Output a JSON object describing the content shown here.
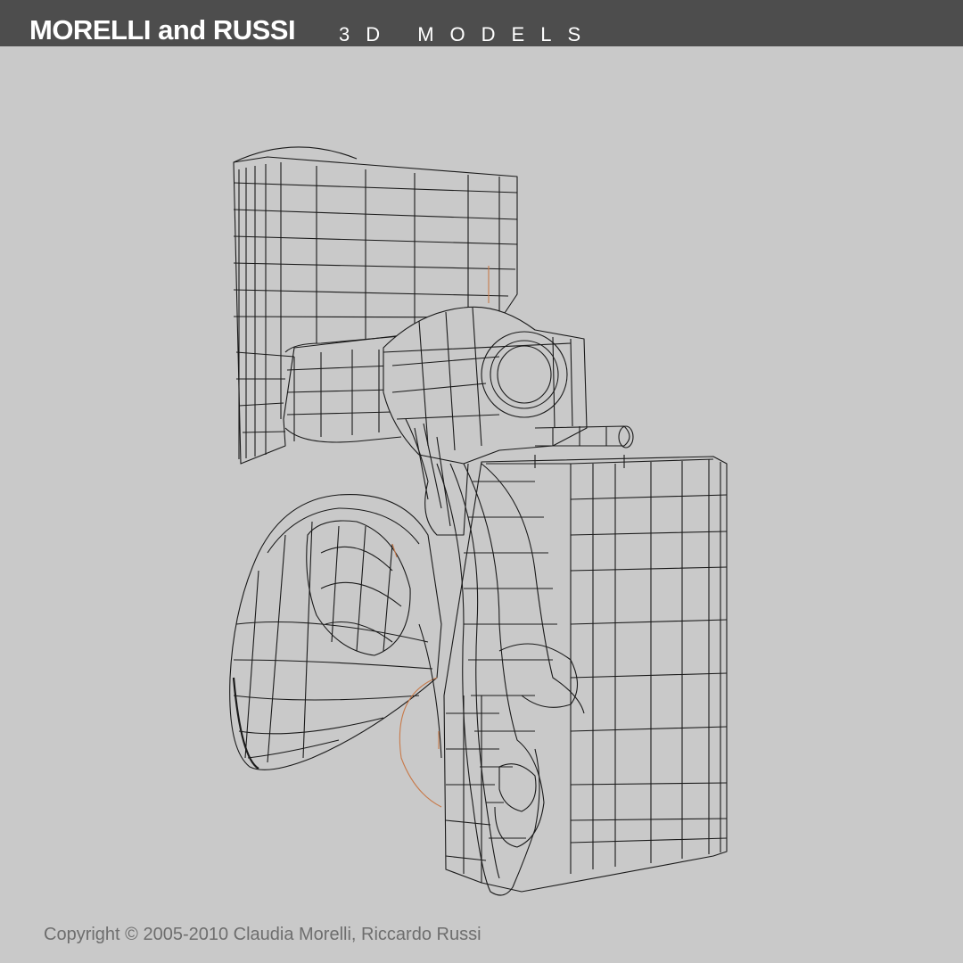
{
  "header": {
    "brand": "MORELLI and RUSSI",
    "tagline": "3D MODELS",
    "background_color": "#4d4d4d"
  },
  "viewport": {
    "background_color": "#c9c9c9",
    "subject_icon": "wireframe-mesh-icon",
    "wire_color": "#1a1a1a",
    "accent_curve_color": "#c87a4a"
  },
  "footer": {
    "copyright": "Copyright © 2005-2010 Claudia Morelli, Riccardo Russi"
  }
}
